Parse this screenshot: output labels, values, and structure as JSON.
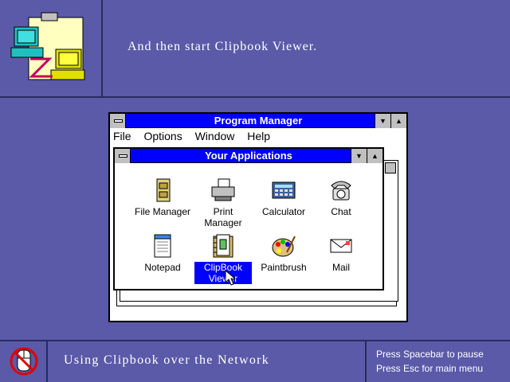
{
  "instruction": "And then start Clipbook Viewer.",
  "course_title": "Using Clipbook over the Network",
  "hints": [
    "Press Spacebar to pause",
    "Press Esc for main menu"
  ],
  "program_manager": {
    "title": "Program Manager",
    "menu": [
      "File",
      "Options",
      "Window",
      "Help"
    ]
  },
  "group_window": {
    "title": "Your Applications",
    "apps": [
      {
        "label": "File Manager",
        "icon": "file-cabinet-icon"
      },
      {
        "label": "Print Manager",
        "icon": "printer-icon"
      },
      {
        "label": "Calculator",
        "icon": "calculator-icon"
      },
      {
        "label": "Chat",
        "icon": "telephone-icon"
      },
      {
        "label": "Notepad",
        "icon": "notepad-icon"
      },
      {
        "label": "ClipBook",
        "label2": "Viewer",
        "icon": "clipbook-icon",
        "selected": true
      },
      {
        "label": "Paintbrush",
        "icon": "palette-icon"
      },
      {
        "label": "Mail",
        "icon": "mail-icon"
      }
    ]
  },
  "colors": {
    "background": "#5a5aa8",
    "title_active": "#0000ff",
    "window": "#ffffff"
  }
}
